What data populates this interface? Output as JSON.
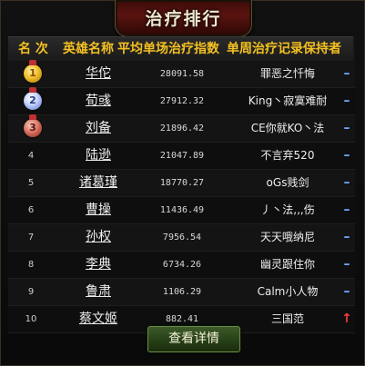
{
  "panel": {
    "title": "治疗排行",
    "details_button": "查看详情"
  },
  "columns": {
    "rank": "名 次",
    "hero": "英雄名称",
    "avg": "平均单场治疗指数",
    "holder": "单周治疗记录保持者"
  },
  "rows": [
    {
      "rank": "1",
      "medal": "gold",
      "name": "华佗",
      "value": "28091.58",
      "holder": "罪恶之忏悔",
      "trend": "down"
    },
    {
      "rank": "2",
      "medal": "silver",
      "name": "荀彧",
      "value": "27912.32",
      "holder": "King丶寂寞难耐",
      "trend": "down"
    },
    {
      "rank": "3",
      "medal": "bronze",
      "name": "刘备",
      "value": "21896.42",
      "holder": "CE你就KO丶法",
      "trend": "down"
    },
    {
      "rank": "4",
      "medal": "",
      "name": "陆逊",
      "value": "21047.89",
      "holder": "不言弃520",
      "trend": "down"
    },
    {
      "rank": "5",
      "medal": "",
      "name": "诸葛瑾",
      "value": "18770.27",
      "holder": "oGs贱剑",
      "trend": "down"
    },
    {
      "rank": "6",
      "medal": "",
      "name": "曹操",
      "value": "11436.49",
      "holder": "丿丶法,,,伤",
      "trend": "down"
    },
    {
      "rank": "7",
      "medal": "",
      "name": "孙权",
      "value": "7956.54",
      "holder": "天天哦纳尼",
      "trend": "down"
    },
    {
      "rank": "8",
      "medal": "",
      "name": "李典",
      "value": "6734.26",
      "holder": "幽灵跟住你",
      "trend": "down"
    },
    {
      "rank": "9",
      "medal": "",
      "name": "鲁肃",
      "value": "1106.29",
      "holder": "Calm小人物",
      "trend": "down"
    },
    {
      "rank": "10",
      "medal": "",
      "name": "蔡文姬",
      "value": "882.41",
      "holder": "三国范",
      "trend": "up"
    }
  ],
  "icons": {
    "trend_down": "–",
    "trend_up": "↑"
  },
  "colors": {
    "header_text": "#f3c021",
    "trend_down": "#6fa6ff",
    "trend_up": "#ff3a3a",
    "button_bg": "#274018"
  }
}
